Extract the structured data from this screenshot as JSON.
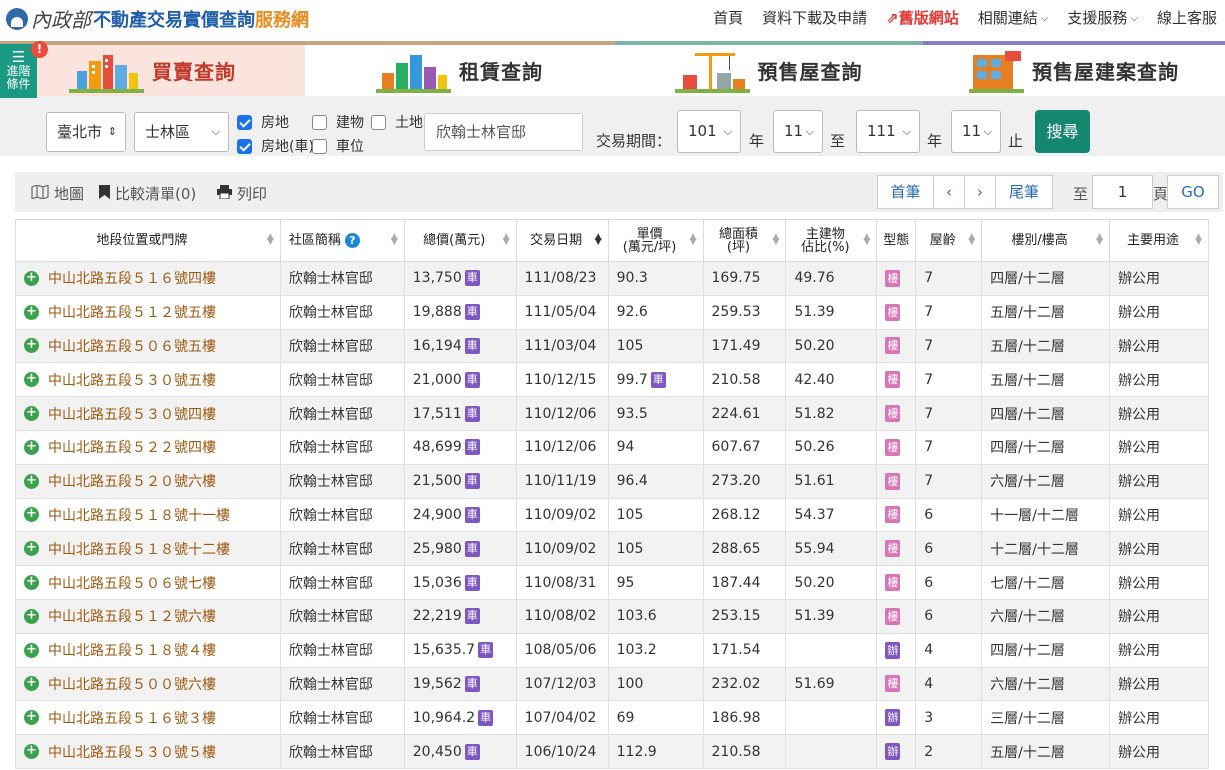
{
  "header": {
    "logo_script": "內政部",
    "logo_main": "不動產交易實價查詢",
    "logo_sub": "服務網",
    "nav": [
      {
        "label": "首頁"
      },
      {
        "label": "資料下載及申請"
      },
      {
        "label": "舊版網站"
      },
      {
        "label": "相關連結"
      },
      {
        "label": "支援服務"
      },
      {
        "label": "線上客服"
      }
    ]
  },
  "advanced": {
    "label": "進階條件",
    "badge": "!"
  },
  "tabs": [
    {
      "label": "買賣查詢",
      "active": true
    },
    {
      "label": "租賃查詢"
    },
    {
      "label": "預售屋查詢"
    },
    {
      "label": "預售屋建案查詢"
    }
  ],
  "search": {
    "city": "臺北市",
    "district": "士林區",
    "checkboxes": [
      {
        "label": "房地",
        "checked": true
      },
      {
        "label": "建物",
        "checked": false
      },
      {
        "label": "土地",
        "checked": false
      },
      {
        "label": "房地(車)",
        "checked": true
      },
      {
        "label": "車位",
        "checked": false
      }
    ],
    "keyword": "欣翰士林官邸",
    "period_label": "交易期間：",
    "from_year": "101",
    "from_month": "11",
    "to_year": "111",
    "to_month": "11",
    "year_unit": "年",
    "to_label": "至",
    "end_label": "止",
    "search_button": "搜尋"
  },
  "toolbar": {
    "map_label": "地圖",
    "compare_label": "比較清單(0)",
    "print_label": "列印",
    "first_label": "首筆",
    "prev_label": "‹",
    "next_label": "›",
    "last_label": "尾筆",
    "to_label": "至",
    "page_value": "1",
    "page_unit": "頁",
    "go_label": "GO"
  },
  "table": {
    "headers": [
      "地段位置或門牌",
      "社區簡稱",
      "總價(萬元)",
      "交易日期",
      "單價\n(萬元/坪)",
      "總面積\n(坪)",
      "主建物\n佔比(%)",
      "型態",
      "屋齡",
      "樓別/樓高",
      "主要用途"
    ],
    "rows": [
      {
        "addr": "中山北路五段５１６號四樓",
        "community": "欣翰士林官邸",
        "total": "13,750",
        "car": true,
        "date": "111/08/23",
        "unit": "90.3",
        "unit_car": false,
        "area": "169.75",
        "ratio": "49.76",
        "type": "樓",
        "age": "7",
        "floor": "四層/十二層",
        "use": "辦公用"
      },
      {
        "addr": "中山北路五段５１２號五樓",
        "community": "欣翰士林官邸",
        "total": "19,888",
        "car": true,
        "date": "111/05/04",
        "unit": "92.6",
        "unit_car": false,
        "area": "259.53",
        "ratio": "51.39",
        "type": "樓",
        "age": "7",
        "floor": "五層/十二層",
        "use": "辦公用"
      },
      {
        "addr": "中山北路五段５０６號五樓",
        "community": "欣翰士林官邸",
        "total": "16,194",
        "car": true,
        "date": "111/03/04",
        "unit": "105",
        "unit_car": false,
        "area": "171.49",
        "ratio": "50.20",
        "type": "樓",
        "age": "7",
        "floor": "五層/十二層",
        "use": "辦公用"
      },
      {
        "addr": "中山北路五段５３０號五樓",
        "community": "欣翰士林官邸",
        "total": "21,000",
        "car": true,
        "date": "110/12/15",
        "unit": "99.7",
        "unit_car": true,
        "area": "210.58",
        "ratio": "42.40",
        "type": "樓",
        "age": "7",
        "floor": "五層/十二層",
        "use": "辦公用"
      },
      {
        "addr": "中山北路五段５３０號四樓",
        "community": "欣翰士林官邸",
        "total": "17,511",
        "car": true,
        "date": "110/12/06",
        "unit": "93.5",
        "unit_car": false,
        "area": "224.61",
        "ratio": "51.82",
        "type": "樓",
        "age": "7",
        "floor": "四層/十二層",
        "use": "辦公用"
      },
      {
        "addr": "中山北路五段５２２號四樓",
        "community": "欣翰士林官邸",
        "total": "48,699",
        "car": true,
        "date": "110/12/06",
        "unit": "94",
        "unit_car": false,
        "area": "607.67",
        "ratio": "50.26",
        "type": "樓",
        "age": "7",
        "floor": "四層/十二層",
        "use": "辦公用"
      },
      {
        "addr": "中山北路五段５２０號六樓",
        "community": "欣翰士林官邸",
        "total": "21,500",
        "car": true,
        "date": "110/11/19",
        "unit": "96.4",
        "unit_car": false,
        "area": "273.20",
        "ratio": "51.61",
        "type": "樓",
        "age": "7",
        "floor": "六層/十二層",
        "use": "辦公用"
      },
      {
        "addr": "中山北路五段５１８號十一樓",
        "community": "欣翰士林官邸",
        "total": "24,900",
        "car": true,
        "date": "110/09/02",
        "unit": "105",
        "unit_car": false,
        "area": "268.12",
        "ratio": "54.37",
        "type": "樓",
        "age": "6",
        "floor": "十一層/十二層",
        "use": "辦公用"
      },
      {
        "addr": "中山北路五段５１８號十二樓",
        "community": "欣翰士林官邸",
        "total": "25,980",
        "car": true,
        "date": "110/09/02",
        "unit": "105",
        "unit_car": false,
        "area": "288.65",
        "ratio": "55.94",
        "type": "樓",
        "age": "6",
        "floor": "十二層/十二層",
        "use": "辦公用"
      },
      {
        "addr": "中山北路五段５０６號七樓",
        "community": "欣翰士林官邸",
        "total": "15,036",
        "car": true,
        "date": "110/08/31",
        "unit": "95",
        "unit_car": false,
        "area": "187.44",
        "ratio": "50.20",
        "type": "樓",
        "age": "6",
        "floor": "七層/十二層",
        "use": "辦公用"
      },
      {
        "addr": "中山北路五段５１２號六樓",
        "community": "欣翰士林官邸",
        "total": "22,219",
        "car": true,
        "date": "110/08/02",
        "unit": "103.6",
        "unit_car": false,
        "area": "253.15",
        "ratio": "51.39",
        "type": "樓",
        "age": "6",
        "floor": "六層/十二層",
        "use": "辦公用"
      },
      {
        "addr": "中山北路五段５１８號４樓",
        "community": "欣翰士林官邸",
        "total": "15,635.7",
        "car": true,
        "date": "108/05/06",
        "unit": "103.2",
        "unit_car": false,
        "area": "171.54",
        "ratio": "",
        "type": "辦",
        "age": "4",
        "floor": "四層/十二層",
        "use": "辦公用"
      },
      {
        "addr": "中山北路五段５００號六樓",
        "community": "欣翰士林官邸",
        "total": "19,562",
        "car": true,
        "date": "107/12/03",
        "unit": "100",
        "unit_car": false,
        "area": "232.02",
        "ratio": "51.69",
        "type": "樓",
        "age": "4",
        "floor": "六層/十二層",
        "use": "辦公用"
      },
      {
        "addr": "中山北路五段５１６號３樓",
        "community": "欣翰士林官邸",
        "total": "10,964.2",
        "car": true,
        "date": "107/04/02",
        "unit": "69",
        "unit_car": false,
        "area": "186.98",
        "ratio": "",
        "type": "辦",
        "age": "3",
        "floor": "三層/十二層",
        "use": "辦公用"
      },
      {
        "addr": "中山北路五段５３０號５樓",
        "community": "欣翰士林官邸",
        "total": "20,450",
        "car": true,
        "date": "106/10/24",
        "unit": "112.9",
        "unit_car": false,
        "area": "210.58",
        "ratio": "",
        "type": "辦",
        "age": "2",
        "floor": "五層/十二層",
        "use": "辦公用"
      }
    ],
    "car_badge": "車"
  },
  "colors": {
    "accent": "#13876f",
    "address": "#9c5a12",
    "type_lou": "#d975b5",
    "type_ban": "#7e57c2",
    "car_badge": "#7e57c2"
  }
}
